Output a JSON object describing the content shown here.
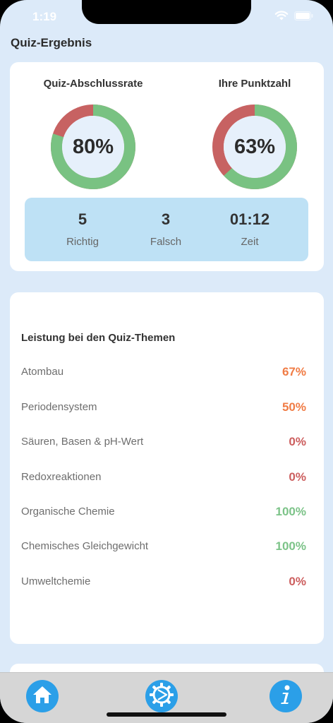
{
  "status_bar": {
    "time": "1:19"
  },
  "header": {
    "title": "Quiz-Ergebnis"
  },
  "summary": {
    "completion": {
      "title": "Quiz-Abschlussrate",
      "value_text": "80%",
      "value": 80
    },
    "score": {
      "title": "Ihre Punktzahl",
      "value_text": "63%",
      "value": 63
    },
    "stats": [
      {
        "value": "5",
        "label": "Richtig"
      },
      {
        "value": "3",
        "label": "Falsch"
      },
      {
        "value": "01:12",
        "label": "Zeit"
      }
    ]
  },
  "topics": {
    "title": "Leistung bei den Quiz-Themen",
    "items": [
      {
        "name": "Atombau",
        "pct": "67%",
        "color": "#f07c45"
      },
      {
        "name": "Periodensystem",
        "pct": "50%",
        "color": "#f07c45"
      },
      {
        "name": "Säuren, Basen & pH-Wert",
        "pct": "0%",
        "color": "#cc5e5e"
      },
      {
        "name": "Redoxreaktionen",
        "pct": "0%",
        "color": "#cc5e5e"
      },
      {
        "name": "Organische Chemie",
        "pct": "100%",
        "color": "#7cc388"
      },
      {
        "name": "Chemisches Gleichgewicht",
        "pct": "100%",
        "color": "#7cc388"
      },
      {
        "name": "Umweltchemie",
        "pct": "0%",
        "color": "#cc5e5e"
      }
    ]
  },
  "colors": {
    "ring_good": "#79c282",
    "ring_bad": "#c76262",
    "ring_inner": "#e6f0fb",
    "accent": "#2b9fe8"
  },
  "tab_bar": {
    "items": [
      {
        "icon": "home-icon"
      },
      {
        "icon": "gear-icon"
      },
      {
        "icon": "info-icon"
      }
    ]
  }
}
